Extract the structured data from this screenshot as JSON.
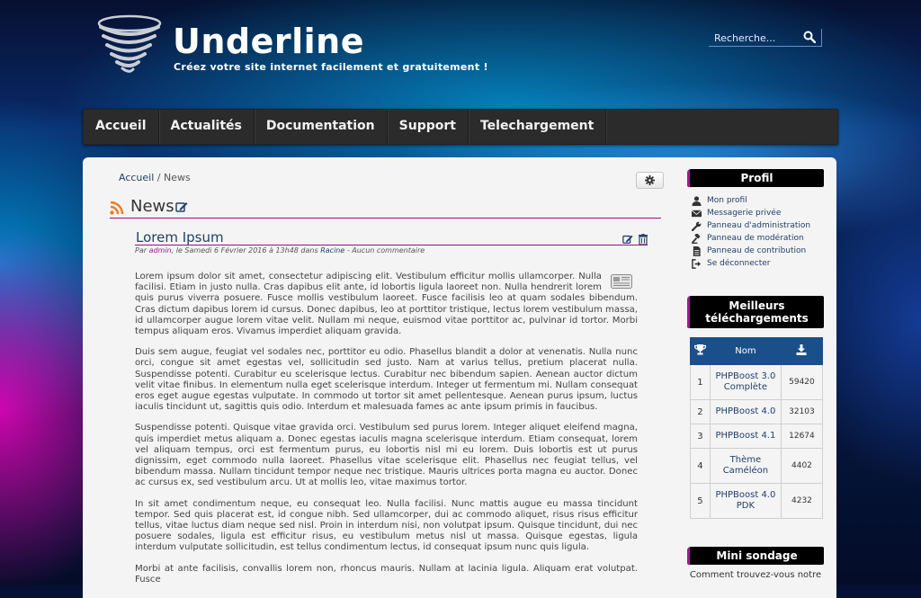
{
  "header": {
    "title": "Underline",
    "slogan": "Créez votre site internet facilement et gratuitement !",
    "search_placeholder": "Recherche..."
  },
  "nav": [
    "Accueil",
    "Actualités",
    "Documentation",
    "Support",
    "Telechargement"
  ],
  "breadcrumb": {
    "home": "Accueil",
    "separator": "/",
    "current": "News"
  },
  "news_section": {
    "title": "News"
  },
  "article": {
    "title": "Lorem Ipsum",
    "meta": {
      "prefix": "Par ",
      "author": "admin",
      "date_text": ", le Samedi 6 Février 2016 à 13h48 dans ",
      "category": "Racine",
      "comments": " - Aucun commentaire"
    },
    "paragraphs": [
      "Lorem ipsum dolor sit amet, consectetur adipiscing elit. Vestibulum efficitur mollis ullamcorper. Nulla facilisi. Etiam in justo nulla. Cras dapibus elit ante, id lobortis ligula laoreet non. Nulla hendrerit lorem quis purus viverra posuere. Fusce mollis vestibulum laoreet. Fusce facilisis leo at quam sodales bibendum. Cras dictum dapibus lorem id cursus. Donec dapibus, leo at porttitor tristique, lectus lorem vestibulum massa, id ullamcorper augue lorem vitae velit. Nullam mi neque, euismod vitae porttitor ac, pulvinar id tortor. Morbi tempus aliquam eros. Vivamus imperdiet aliquam gravida.",
      "Duis sem augue, feugiat vel sodales nec, porttitor eu odio. Phasellus blandit a dolor at venenatis. Nulla nunc orci, congue sit amet egestas vel, sollicitudin sed justo. Nam at varius tellus, pretium placerat nulla. Suspendisse potenti. Curabitur eu scelerisque lectus. Curabitur nec bibendum sapien. Aenean auctor dictum velit vitae finibus. In elementum nulla eget scelerisque interdum. Integer ut fermentum mi. Nullam consequat eros eget augue egestas vulputate. In commodo ut tortor sit amet pellentesque. Aenean purus ipsum, luctus iaculis tincidunt ut, sagittis quis odio. Interdum et malesuada fames ac ante ipsum primis in faucibus.",
      "Suspendisse potenti. Quisque vitae gravida orci. Vestibulum sed purus lorem. Integer aliquet eleifend magna, quis imperdiet metus aliquam a. Donec egestas iaculis magna scelerisque interdum. Etiam consequat, lorem vel aliquam tempus, orci est fermentum purus, eu lobortis nisl mi eu lorem. Duis lobortis est ut purus dignissim, eget commodo nulla laoreet. Phasellus vitae scelerisque elit. Phasellus nec feugiat tellus, vel bibendum massa. Nullam tincidunt tempor neque nec tristique. Mauris ultrices porta magna eu auctor. Donec ac cursus ex, sed vestibulum arcu. Ut at mollis leo, vitae maximus tortor.",
      "In sit amet condimentum neque, eu consequat leo. Nulla facilisi. Nunc mattis augue eu massa tincidunt tempor. Sed quis placerat est, id congue nibh. Sed ullamcorper, dui ac commodo aliquet, risus risus efficitur tellus, vitae luctus diam neque sed nisl. Proin in interdum nisi, non volutpat ipsum. Quisque tincidunt, dui nec posuere sodales, ligula est efficitur risus, eu vestibulum metus nisl ut massa. Quisque egestas, ligula interdum vulputate sollicitudin, est tellus condimentum lectus, id consequat ipsum nunc quis ligula.",
      "Morbi at ante facilisis, convallis lorem non, rhoncus mauris. Nullam at lacinia ligula. Aliquam erat volutpat. Fusce"
    ]
  },
  "profil": {
    "title": "Profil",
    "items": [
      {
        "label": "Mon profil",
        "icon": "user-icon"
      },
      {
        "label": "Messagerie privée",
        "icon": "envelope-icon"
      },
      {
        "label": "Panneau d'administration",
        "icon": "wrench-icon"
      },
      {
        "label": "Panneau de modération",
        "icon": "gavel-icon"
      },
      {
        "label": "Panneau de contribution",
        "icon": "file-icon"
      },
      {
        "label": "Se déconnecter",
        "icon": "sign-out-icon"
      }
    ]
  },
  "downloads": {
    "title_line1": "Meilleurs",
    "title_line2": "téléchargements",
    "header_name": "Nom",
    "rows": [
      {
        "rank": "1",
        "name": "PHPBoost 3.0 Complète",
        "count": "59420"
      },
      {
        "rank": "2",
        "name": "PHPBoost 4.0",
        "count": "32103"
      },
      {
        "rank": "3",
        "name": "PHPBoost 4.1",
        "count": "12674"
      },
      {
        "rank": "4",
        "name": "Thème Caméléon",
        "count": "4402"
      },
      {
        "rank": "5",
        "name": "PHPBoost 4.0 PDK",
        "count": "4232"
      }
    ]
  },
  "poll": {
    "title": "Mini sondage",
    "question": "Comment trouvez-vous notre"
  },
  "colors": {
    "accent": "#9a0f7f",
    "link": "#21416b",
    "table_header": "#1b4f8a",
    "nav_bg": "#2b2b2b"
  }
}
